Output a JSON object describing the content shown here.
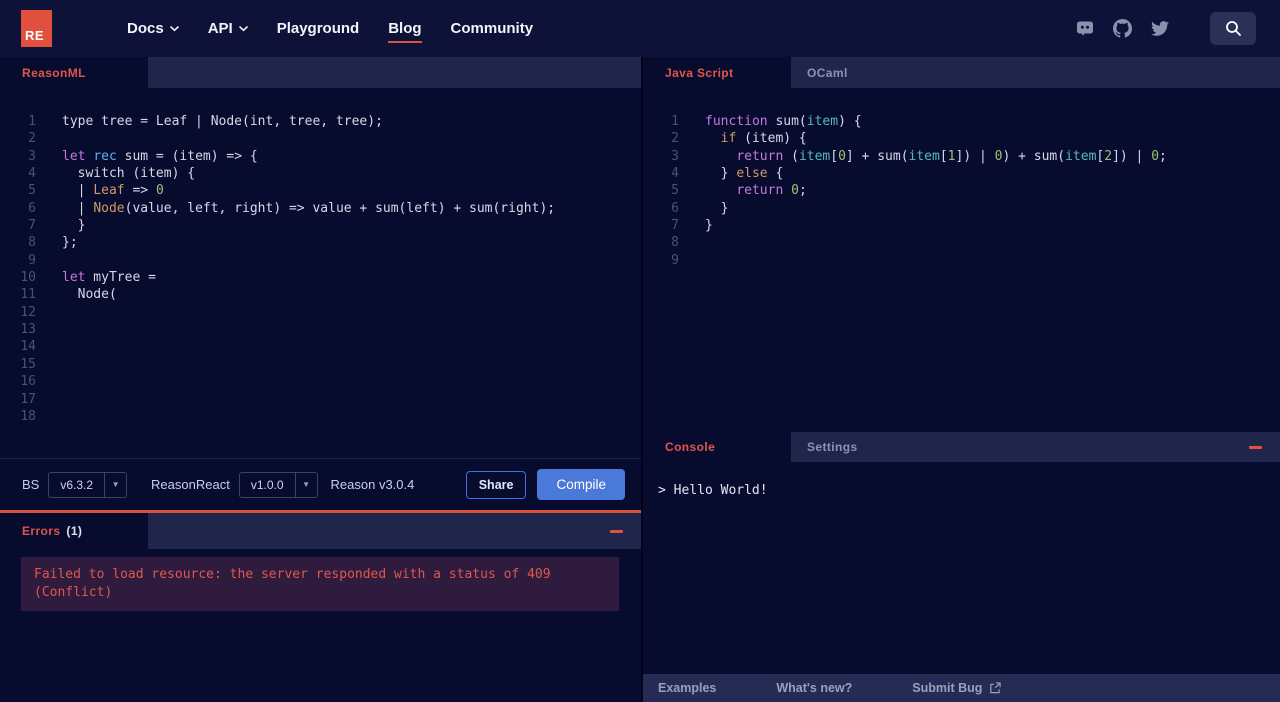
{
  "nav": {
    "logo": "RE",
    "items": [
      {
        "label": "Docs",
        "chevron": true,
        "active": false
      },
      {
        "label": "API",
        "chevron": true,
        "active": false
      },
      {
        "label": "Playground",
        "chevron": false,
        "active": false
      },
      {
        "label": "Blog",
        "chevron": false,
        "active": true
      },
      {
        "label": "Community",
        "chevron": false,
        "active": false
      }
    ],
    "social_icons": [
      "discord-icon",
      "github-icon",
      "twitter-icon"
    ],
    "search_icon": "magnifier"
  },
  "colors": {
    "accent_red": "#e0503f",
    "compile_blue": "#4a79da",
    "error_bg": "#2e1b3e",
    "error_text": "#e2574b"
  },
  "left_editor": {
    "tab_label": "ReasonML",
    "line_count": 18,
    "lines": [
      [
        [
          "d",
          "type tree = Leaf | Node(int, tree, tree);"
        ]
      ],
      [],
      [
        [
          "k",
          "let"
        ],
        [
          "d",
          " "
        ],
        [
          "b",
          "rec"
        ],
        [
          "d",
          " sum = (item) => {"
        ]
      ],
      [
        [
          "d",
          "  switch (item) {"
        ]
      ],
      [
        [
          "d",
          "  | "
        ],
        [
          "o",
          "Leaf"
        ],
        [
          "d",
          " => "
        ],
        [
          "g",
          "0"
        ]
      ],
      [
        [
          "d",
          "  | "
        ],
        [
          "o",
          "Node"
        ],
        [
          "d",
          "(value, left, right) => value + sum(left) + sum(right);"
        ]
      ],
      [
        [
          "d",
          "  }"
        ]
      ],
      [
        [
          "d",
          "};"
        ]
      ],
      [],
      [
        [
          "k",
          "let"
        ],
        [
          "d",
          " myTree ="
        ]
      ],
      [
        [
          "d",
          "  Node("
        ]
      ],
      [],
      [],
      [],
      [],
      [],
      [],
      []
    ]
  },
  "right_editor": {
    "tabs": [
      {
        "label": "Java Script",
        "active": true
      },
      {
        "label": "OCaml",
        "active": false
      }
    ],
    "line_count": 9,
    "lines": [
      [
        [
          "k",
          "function"
        ],
        [
          "d",
          " sum("
        ],
        [
          "c",
          "item"
        ],
        [
          "d",
          ") {"
        ]
      ],
      [
        [
          "d",
          "  "
        ],
        [
          "o",
          "if"
        ],
        [
          "d",
          " (item) {"
        ]
      ],
      [
        [
          "d",
          "    "
        ],
        [
          "k",
          "return"
        ],
        [
          "d",
          " ("
        ],
        [
          "c",
          "item"
        ],
        [
          "d",
          "["
        ],
        [
          "g",
          "0"
        ],
        [
          "d",
          "] + sum("
        ],
        [
          "c",
          "item"
        ],
        [
          "d",
          "["
        ],
        [
          "g",
          "1"
        ],
        [
          "d",
          "]) | "
        ],
        [
          "g",
          "0"
        ],
        [
          "d",
          ") + sum("
        ],
        [
          "c",
          "item"
        ],
        [
          "d",
          "["
        ],
        [
          "g",
          "2"
        ],
        [
          "d",
          "]) | "
        ],
        [
          "g",
          "0"
        ],
        [
          "d",
          ";"
        ]
      ],
      [
        [
          "d",
          "  } "
        ],
        [
          "o",
          "else"
        ],
        [
          "d",
          " {"
        ]
      ],
      [
        [
          "d",
          "    "
        ],
        [
          "k",
          "return"
        ],
        [
          "d",
          " "
        ],
        [
          "g",
          "0"
        ],
        [
          "d",
          ";"
        ]
      ],
      [
        [
          "d",
          "  }"
        ]
      ],
      [
        [
          "d",
          "}"
        ]
      ],
      [],
      []
    ]
  },
  "toolbar": {
    "bs_label": "BS",
    "bs_version": "v6.3.2",
    "reasonreact_label": "ReasonReact",
    "reasonreact_version": "v1.0.0",
    "reason_version": "Reason v3.0.4",
    "share_label": "Share",
    "compile_label": "Compile"
  },
  "errors_panel": {
    "title": "Errors",
    "count": "(1)",
    "message": "Failed to load resource: the server responded with a status of 409 (Conflict)"
  },
  "console_panel": {
    "tabs": [
      {
        "label": "Console",
        "active": true
      },
      {
        "label": "Settings",
        "active": false
      }
    ],
    "output": "> Hello World!"
  },
  "footer": {
    "examples": "Examples",
    "whats_new": "What's new?",
    "submit_bug": "Submit Bug"
  }
}
